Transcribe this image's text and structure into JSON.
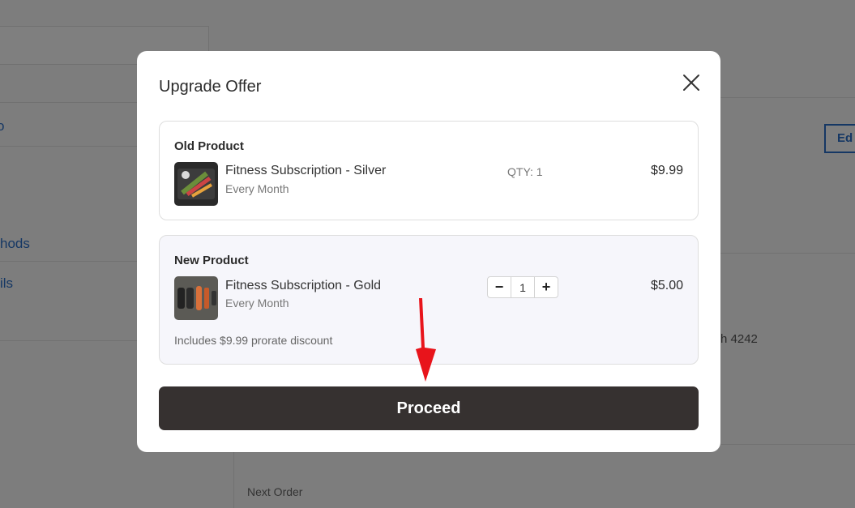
{
  "background": {
    "links": [
      "hods",
      "ils"
    ],
    "edit_label": "Ed",
    "card_text": "h 4242",
    "next_order_label": "Next Order"
  },
  "modal": {
    "title": "Upgrade Offer",
    "close_icon": "close-icon",
    "old_product": {
      "section_label": "Old Product",
      "name": "Fitness Subscription - Silver",
      "frequency": "Every Month",
      "qty_text": "QTY: 1",
      "price": "$9.99"
    },
    "new_product": {
      "section_label": "New Product",
      "name": "Fitness Subscription - Gold",
      "frequency": "Every Month",
      "quantity": "1",
      "minus_label": "−",
      "plus_label": "+",
      "price": "$5.00",
      "discount_note": "Includes $9.99 prorate discount"
    },
    "proceed_label": "Proceed"
  },
  "annotation": {
    "arrow_color": "#e8141b"
  }
}
